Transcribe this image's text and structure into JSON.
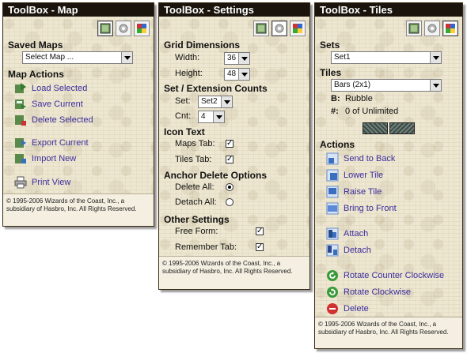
{
  "map_panel": {
    "title": "ToolBox - Map",
    "saved_maps_heading": "Saved Maps",
    "select_map_value": "Select Map ...",
    "map_actions_heading": "Map Actions",
    "actions": [
      {
        "label": "Load Selected",
        "icon": "load-icon"
      },
      {
        "label": "Save Current",
        "icon": "save-icon"
      },
      {
        "label": "Delete Selected",
        "icon": "delete-map-icon"
      },
      {
        "label": "Export Current",
        "icon": "export-icon"
      },
      {
        "label": "Import New",
        "icon": "import-icon"
      },
      {
        "label": "Print View",
        "icon": "printer-icon"
      }
    ],
    "footer": "© 1995-2006 Wizards of the Coast, Inc., a subsidiary of Hasbro, Inc. All Rights Reserved."
  },
  "settings_panel": {
    "title": "ToolBox - Settings",
    "grid_heading": "Grid Dimensions",
    "width_label": "Width:",
    "width_value": "36",
    "height_label": "Height:",
    "height_value": "48",
    "set_heading": "Set / Extension Counts",
    "set_label": "Set:",
    "set_value": "Set2",
    "cnt_label": "Cnt:",
    "cnt_value": "4",
    "icon_text_heading": "Icon Text",
    "maps_tab_label": "Maps Tab:",
    "maps_tab_checked": true,
    "tiles_tab_label": "Tiles Tab:",
    "tiles_tab_checked": true,
    "anchor_heading": "Anchor Delete Options",
    "delete_all_label": "Delete All:",
    "delete_all_selected": true,
    "detach_all_label": "Detach All:",
    "detach_all_selected": false,
    "other_heading": "Other Settings",
    "free_form_label": "Free Form:",
    "free_form_checked": true,
    "remember_tab_label": "Remember Tab:",
    "remember_tab_checked": true,
    "footer": "© 1995-2006 Wizards of the Coast, Inc., a subsidiary of Hasbro, Inc. All Rights Reserved."
  },
  "tiles_panel": {
    "title": "ToolBox - Tiles",
    "sets_heading": "Sets",
    "sets_value": "Set1",
    "tiles_heading": "Tiles",
    "tiles_value": "Bars (2x1)",
    "b_label": "B:",
    "b_value": "Rubble",
    "count_label": "#:",
    "count_value": "0 of Unlimited",
    "actions_heading": "Actions",
    "actions": [
      {
        "label": "Send to Back",
        "icon": "send-to-back-icon"
      },
      {
        "label": "Lower Tile",
        "icon": "lower-tile-icon"
      },
      {
        "label": "Raise Tile",
        "icon": "raise-tile-icon"
      },
      {
        "label": "Bring to Front",
        "icon": "bring-to-front-icon"
      },
      {
        "label": "Attach",
        "icon": "attach-icon"
      },
      {
        "label": "Detach",
        "icon": "detach-icon"
      },
      {
        "label": "Rotate Counter Clockwise",
        "icon": "rotate-ccw-icon"
      },
      {
        "label": "Rotate Clockwise",
        "icon": "rotate-cw-icon"
      },
      {
        "label": "Delete",
        "icon": "delete-tile-icon"
      }
    ],
    "footer": "© 1995-2006 Wizards of the Coast, Inc., a subsidiary of Hasbro, Inc. All Rights Reserved."
  },
  "tab_icons": [
    "map-tab-icon",
    "settings-gear-icon",
    "tiles-tab-icon"
  ],
  "colors": {
    "title_bar": "#1a140d",
    "link": "#3a2d9e",
    "panel_bg": "#ede6d0"
  }
}
